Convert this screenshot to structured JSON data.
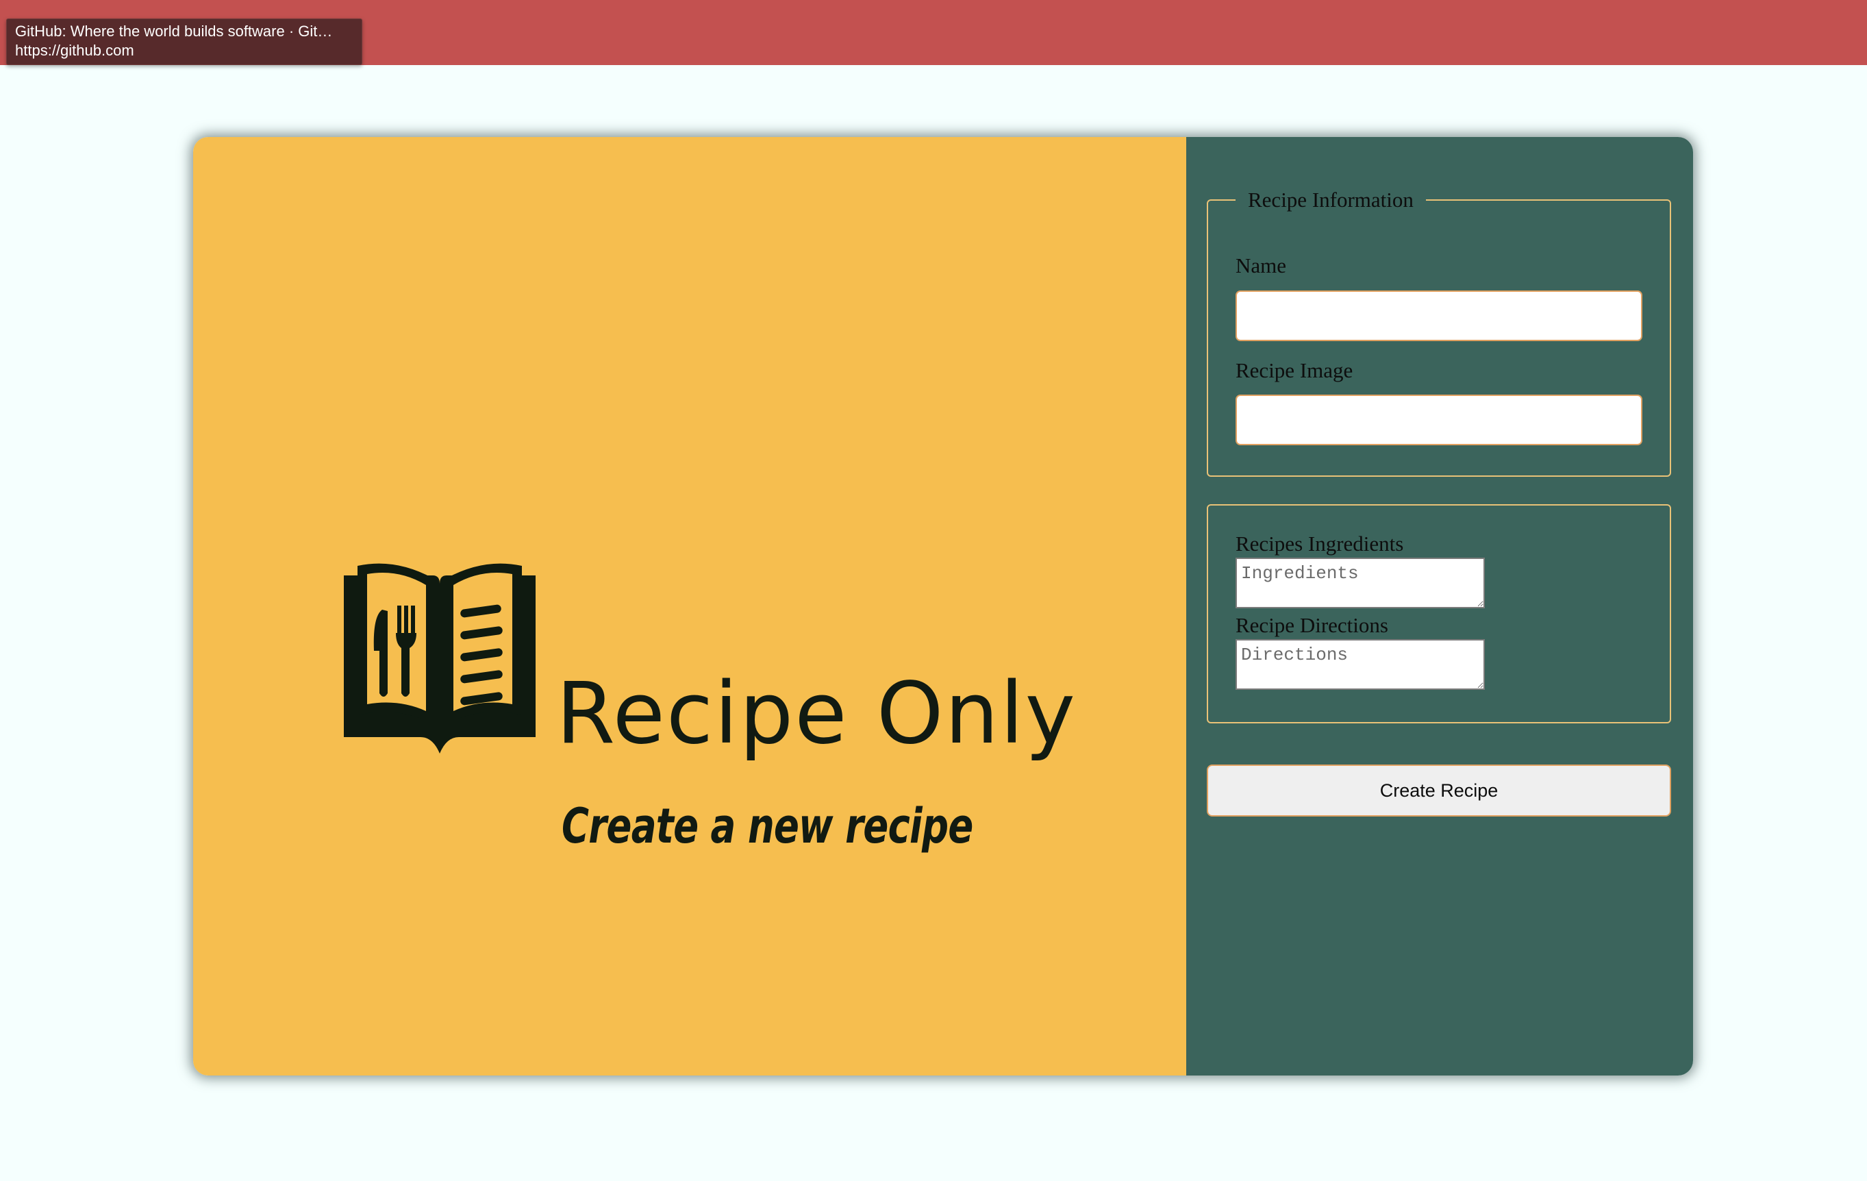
{
  "tooltip": {
    "title": "GitHub: Where the world builds software · Git…",
    "url": "https://github.com"
  },
  "colors": {
    "topbar": "#c35150",
    "hero": "#f6be4f",
    "form_panel": "#3b645c",
    "fieldset_border": "#e9c277"
  },
  "hero": {
    "logo_icon": "book-with-utensils-icon",
    "title": "Recipe Only",
    "subtitle": "Create a new recipe"
  },
  "form": {
    "info_legend": "Recipe Information",
    "name_label": "Name",
    "name_value": "",
    "image_label": "Recipe Image",
    "image_value": "",
    "ingredients_label": "Recipes Ingredients",
    "ingredients_placeholder": "Ingredients",
    "directions_label": "Recipe Directions",
    "directions_placeholder": "Directions",
    "submit_label": "Create Recipe"
  }
}
